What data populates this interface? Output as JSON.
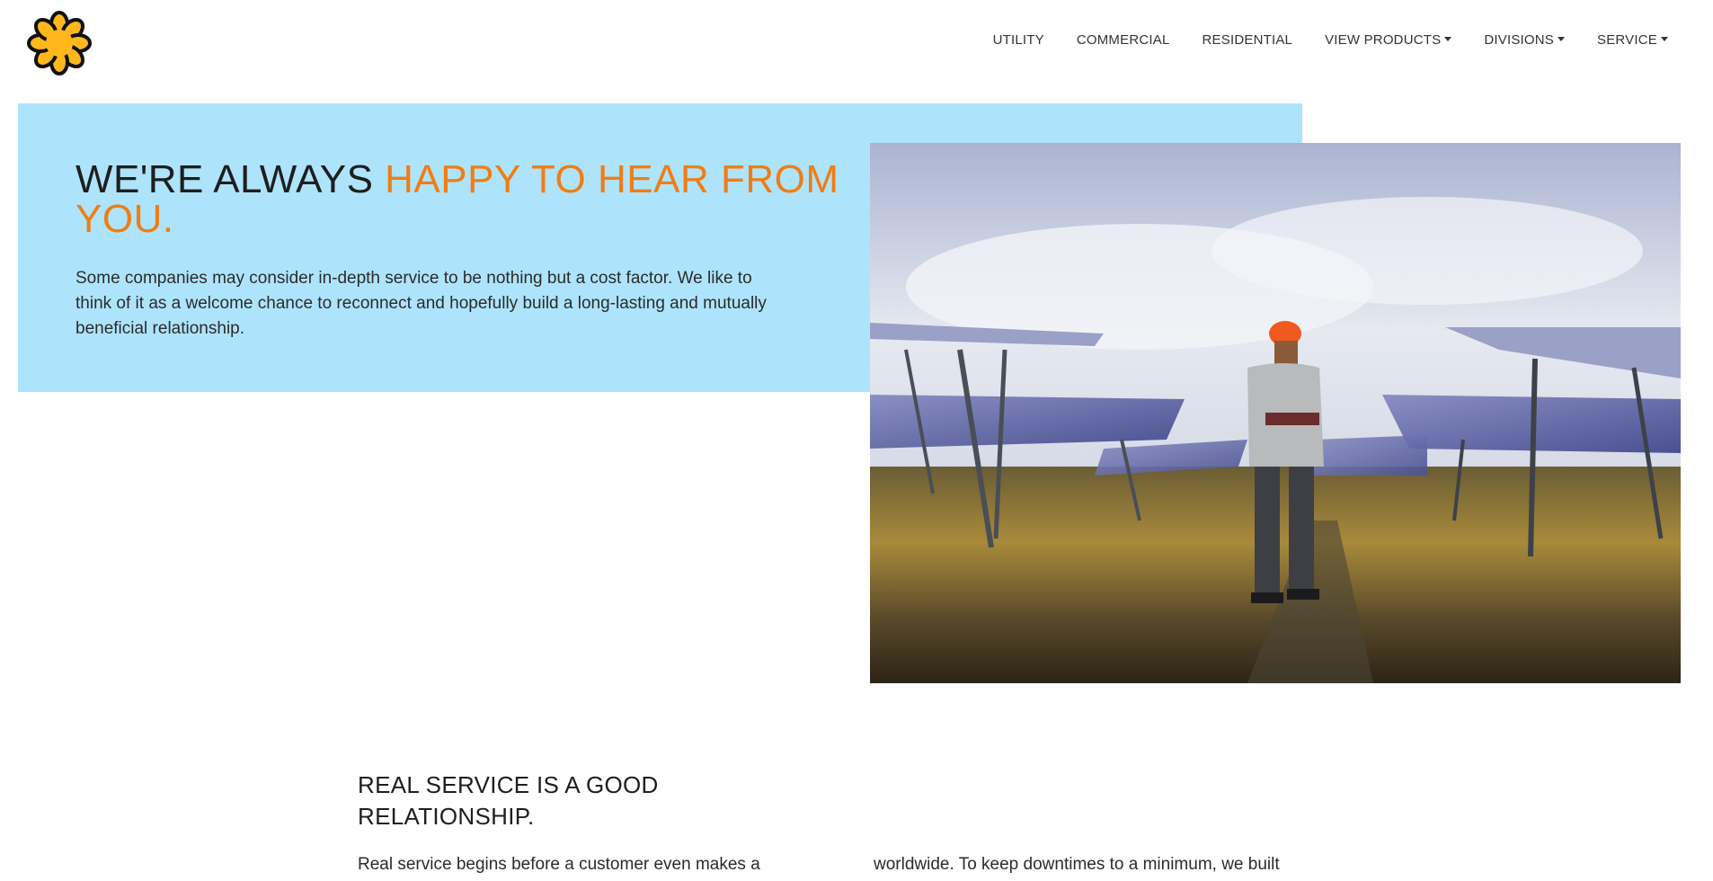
{
  "header": {
    "logo": {
      "icon": "flower-logo-icon",
      "fill": "#ffb81c",
      "stroke": "#111111"
    },
    "nav": [
      {
        "label": "UTILITY",
        "dropdown": false
      },
      {
        "label": "COMMERCIAL",
        "dropdown": false
      },
      {
        "label": "RESIDENTIAL",
        "dropdown": false
      },
      {
        "label": "VIEW PRODUCTS",
        "dropdown": true
      },
      {
        "label": "DIVISIONS",
        "dropdown": true
      },
      {
        "label": "SERVICE",
        "dropdown": true
      }
    ]
  },
  "hero": {
    "title_part1": "WE'RE ALWAYS ",
    "title_accent": "HAPPY TO HEAR FROM YOU.",
    "body": "Some companies may consider in-depth service to be nothing but a cost factor. We like to think of it as a welcome chance to reconnect and hopefully build a long-lasting and mutually beneficial relationship.",
    "colors": {
      "panel": "#aee4fb",
      "accent": "#f07d14"
    },
    "image": "solar-farm-technician-photo"
  },
  "section": {
    "title": "REAL SERVICE IS A GOOD RELATIONSHIP.",
    "col_left": "Real service begins before a customer even makes a",
    "col_right": "worldwide. To keep downtimes to a minimum, we built"
  }
}
